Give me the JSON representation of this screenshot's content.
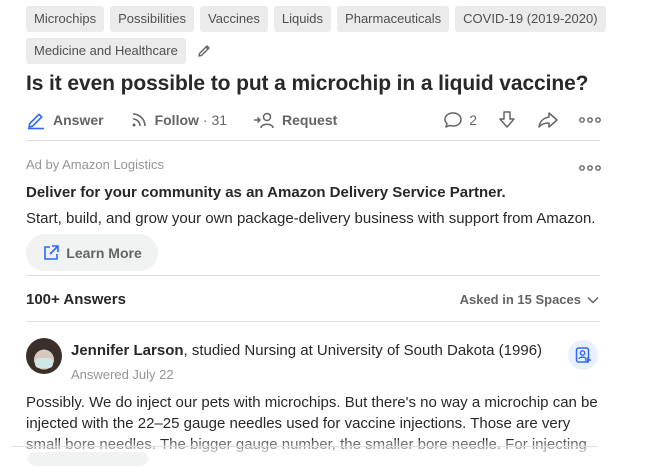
{
  "topics": [
    "Microchips",
    "Possibilities",
    "Vaccines",
    "Liquids",
    "Pharmaceuticals",
    "COVID-19 (2019-2020)",
    "Medicine and Healthcare"
  ],
  "question": {
    "title": "Is it even possible to put a microchip in a liquid vaccine?"
  },
  "actions": {
    "answer_label": "Answer",
    "follow_label": "Follow",
    "follow_count": "· 31",
    "request_label": "Request",
    "comments_count": "2"
  },
  "ad": {
    "by_label": "Ad by Amazon Logistics",
    "title": "Deliver for your community as an Amazon Delivery Service Partner.",
    "description": "Start, build, and grow your own package-delivery business with support from Amazon.",
    "button_label": "Learn More"
  },
  "answers_header": {
    "count_label": "100+ Answers",
    "asked_in_label": "Asked in 15 Spaces"
  },
  "answer": {
    "author_name": "Jennifer Larson",
    "author_credential": ", studied Nursing at University of South Dakota (1996)",
    "date": "Answered July 22",
    "text": "Possibly. We do inject our pets with microchips. But there's no way a microchip can be injected with the 22–25 gauge needles used for vaccine injections. Those are very small bore needles. The bigger gauge number, the smaller bore needle. For injecting"
  },
  "colors": {
    "chip_bg": "#ebebeb",
    "muted_text": "#636466",
    "accent_blue": "#2e69ff"
  }
}
